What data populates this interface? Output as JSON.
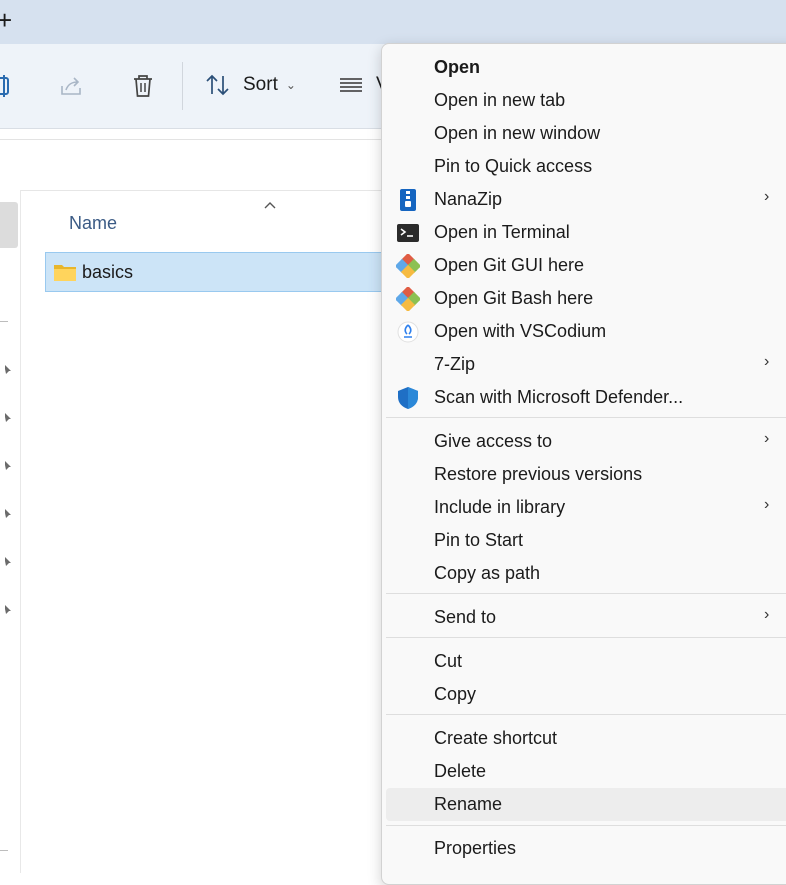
{
  "titlebar": {
    "new_tab_glyph": "+"
  },
  "toolbar": {
    "sort_label": "Sort",
    "view_label": "V",
    "icons": [
      "rename-icon",
      "share-icon",
      "delete-icon",
      "sort-icon",
      "view-icon"
    ]
  },
  "content": {
    "column_name": "Name",
    "files": [
      {
        "name": "basics",
        "icon": "folder-icon",
        "selected": true
      }
    ]
  },
  "context_menu": {
    "items": [
      {
        "label": "Open",
        "bold": true
      },
      {
        "label": "Open in new tab"
      },
      {
        "label": "Open in new window"
      },
      {
        "label": "Pin to Quick access"
      },
      {
        "label": "NanaZip",
        "icon": "nanazip-icon",
        "submenu": true
      },
      {
        "label": "Open in Terminal",
        "icon": "terminal-icon"
      },
      {
        "label": "Open Git GUI here",
        "icon": "git-icon"
      },
      {
        "label": "Open Git Bash here",
        "icon": "git-icon"
      },
      {
        "label": "Open with VSCodium",
        "icon": "vscodium-icon"
      },
      {
        "label": "7-Zip",
        "submenu": true
      },
      {
        "label": "Scan with Microsoft Defender...",
        "icon": "defender-shield-icon"
      },
      {
        "label": "Give access to",
        "submenu": true
      },
      {
        "label": "Restore previous versions"
      },
      {
        "label": "Include in library",
        "submenu": true
      },
      {
        "label": "Pin to Start"
      },
      {
        "label": "Copy as path"
      },
      {
        "label": "Send to",
        "submenu": true
      },
      {
        "label": "Cut"
      },
      {
        "label": "Copy"
      },
      {
        "label": "Create shortcut"
      },
      {
        "label": "Delete"
      },
      {
        "label": "Rename",
        "hovered": true
      },
      {
        "label": "Properties"
      }
    ],
    "submenu_glyph": "›"
  },
  "colors": {
    "accent": "#0067c0",
    "selection": "#cce4f7",
    "titlebar": "#d6e1ef",
    "toolbar": "#eef3f9"
  }
}
